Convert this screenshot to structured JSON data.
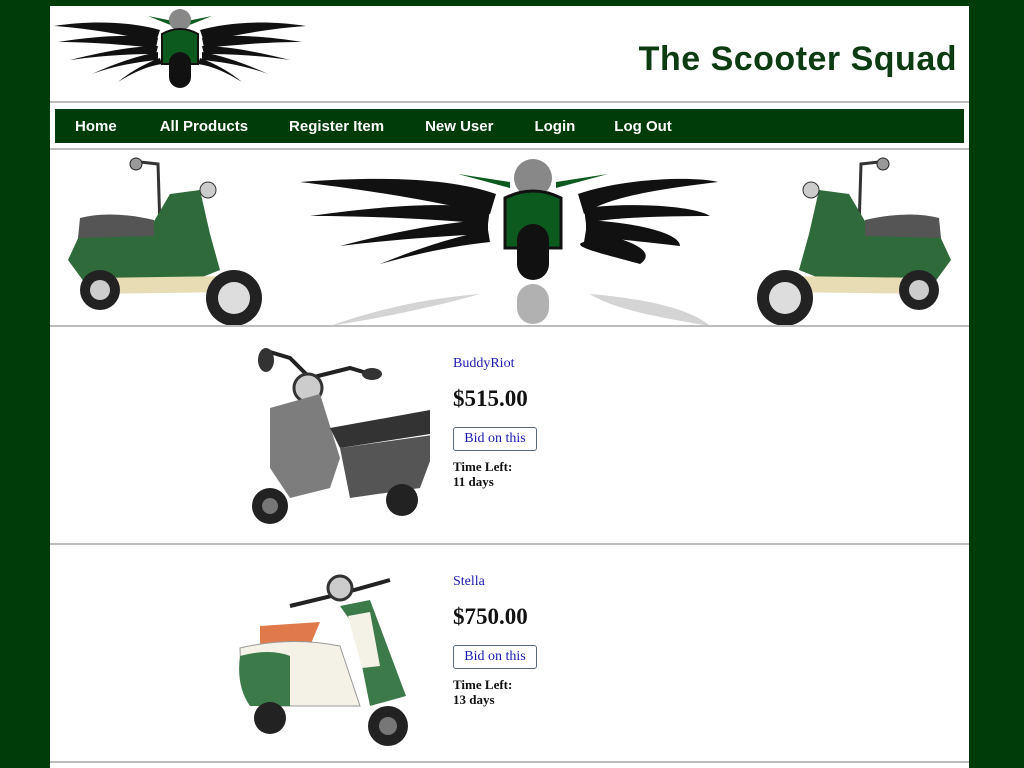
{
  "site": {
    "title": "The Scooter Squad"
  },
  "nav": {
    "items": [
      {
        "label": "Home"
      },
      {
        "label": "All Products"
      },
      {
        "label": "Register Item"
      },
      {
        "label": "New User"
      },
      {
        "label": "Login"
      },
      {
        "label": "Log Out"
      }
    ]
  },
  "colors": {
    "brand_green": "#003b0a",
    "link_blue": "#1a1ab3"
  },
  "products": [
    {
      "name": "BuddyRiot",
      "price": "$515.00",
      "bid_label": "Bid on this",
      "time_left_label": "Time Left:",
      "time_left_value": "11 days",
      "image": "gray-scooter"
    },
    {
      "name": "Stella",
      "price": "$750.00",
      "bid_label": "Bid on this",
      "time_left_label": "Time Left:",
      "time_left_value": "13 days",
      "image": "green-cream-vintage-scooter"
    }
  ]
}
